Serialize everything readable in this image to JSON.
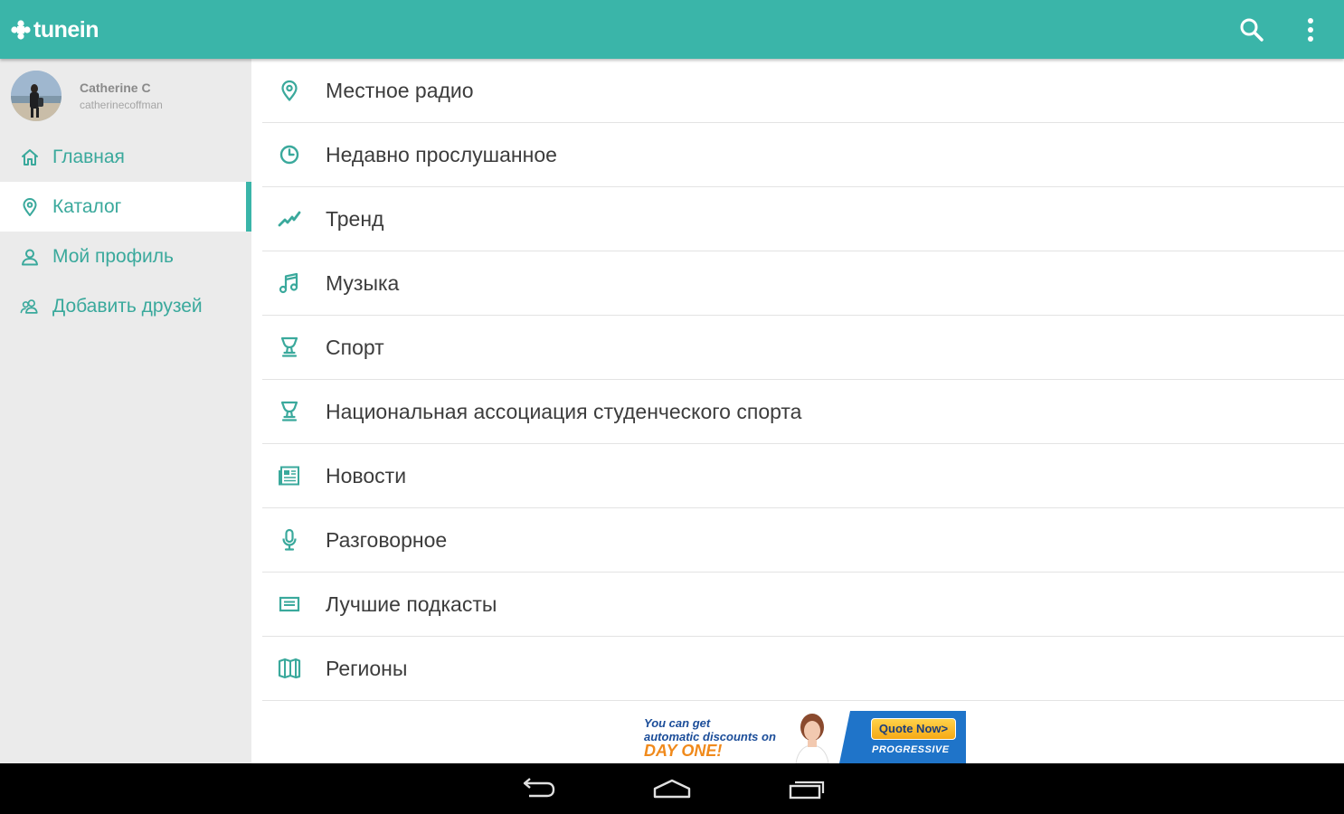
{
  "app": {
    "logo_text": "tunein",
    "brand_color": "#3ab5a9"
  },
  "toolbar": {
    "search_icon": "search-icon",
    "overflow_icon": "more-vert-icon"
  },
  "user": {
    "name": "Catherine C",
    "handle": "catherinecoffman"
  },
  "sidebar": {
    "items": [
      {
        "label": "Главная",
        "icon": "home-icon",
        "active": false
      },
      {
        "label": "Каталог",
        "icon": "location-pin-icon",
        "active": true
      },
      {
        "label": "Мой профиль",
        "icon": "person-icon",
        "active": false
      },
      {
        "label": "Добавить друзей",
        "icon": "add-friends-icon",
        "active": false
      }
    ]
  },
  "catalog": {
    "items": [
      {
        "label": "Местное радио",
        "icon": "location-pin-icon"
      },
      {
        "label": "Недавно прослушанное",
        "icon": "clock-icon"
      },
      {
        "label": "Тренд",
        "icon": "trend-icon"
      },
      {
        "label": "Музыка",
        "icon": "music-note-icon"
      },
      {
        "label": "Спорт",
        "icon": "trophy-icon"
      },
      {
        "label": "Национальная ассоциация студенческого спорта",
        "icon": "trophy-icon"
      },
      {
        "label": "Новости",
        "icon": "newspaper-icon"
      },
      {
        "label": "Разговорное",
        "icon": "microphone-icon"
      },
      {
        "label": "Лучшие подкасты",
        "icon": "podcast-list-icon"
      },
      {
        "label": "Регионы",
        "icon": "map-icon"
      }
    ]
  },
  "ad": {
    "line1": "You can get",
    "line2": "automatic discounts on",
    "line3": "DAY ONE!",
    "button": "Quote Now>",
    "brand": "PROGRESSIVE"
  },
  "system_nav": {
    "back_icon": "back-icon",
    "home_icon": "home-outline-icon",
    "recents_icon": "recents-icon"
  }
}
